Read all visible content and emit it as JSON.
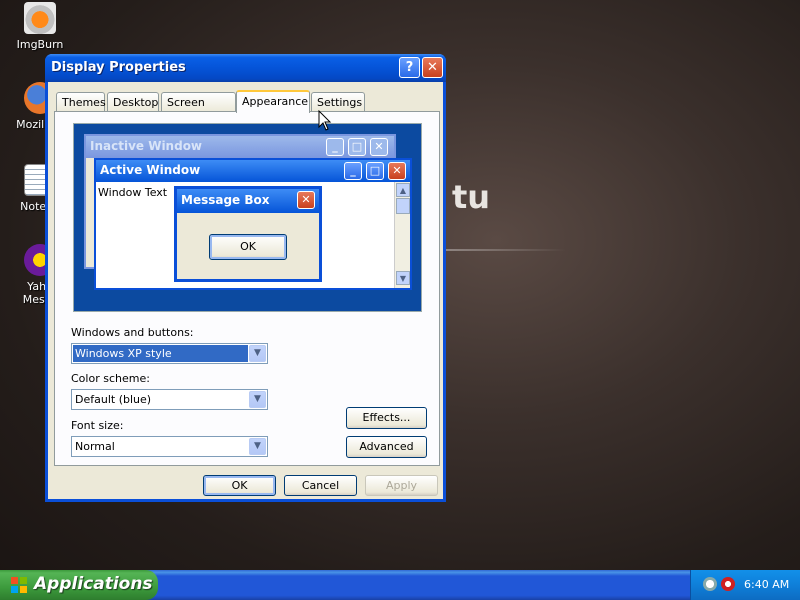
{
  "desktop": {
    "wallpaper_text": "tu",
    "icons": [
      {
        "label": "ImgBurn",
        "icon": "imgburn-icon"
      },
      {
        "label": "Mozilla F",
        "icon": "firefox-icon"
      },
      {
        "label": "Notepa",
        "icon": "notepad-icon"
      },
      {
        "label": "Yaho",
        "label2": "Messe",
        "icon": "yahoo-messenger-icon"
      }
    ]
  },
  "window": {
    "title": "Display Properties",
    "help_label": "?",
    "close_label": "✕",
    "tabs": [
      {
        "label": "Themes"
      },
      {
        "label": "Desktop"
      },
      {
        "label": "Screen Saver"
      },
      {
        "label": "Appearance",
        "active": true
      },
      {
        "label": "Settings"
      }
    ],
    "preview": {
      "inactive_title": "Inactive Window",
      "active_title": "Active Window",
      "window_text": "Window Text",
      "message_title": "Message Box",
      "ok_label": "OK"
    },
    "fields": {
      "windows_buttons_label": "Windows and buttons:",
      "windows_buttons_value": "Windows XP style",
      "color_scheme_label": "Color scheme:",
      "color_scheme_value": "Default (blue)",
      "font_size_label": "Font size:",
      "font_size_value": "Normal"
    },
    "buttons": {
      "effects": "Effects...",
      "advanced": "Advanced",
      "ok": "OK",
      "cancel": "Cancel",
      "apply": "Apply"
    }
  },
  "taskbar": {
    "start_label": "Applications",
    "time": "6:40 AM"
  },
  "colors": {
    "title_blue": "#0554d8",
    "start_green": "#3c9a3c",
    "close_red": "#c8401e"
  }
}
